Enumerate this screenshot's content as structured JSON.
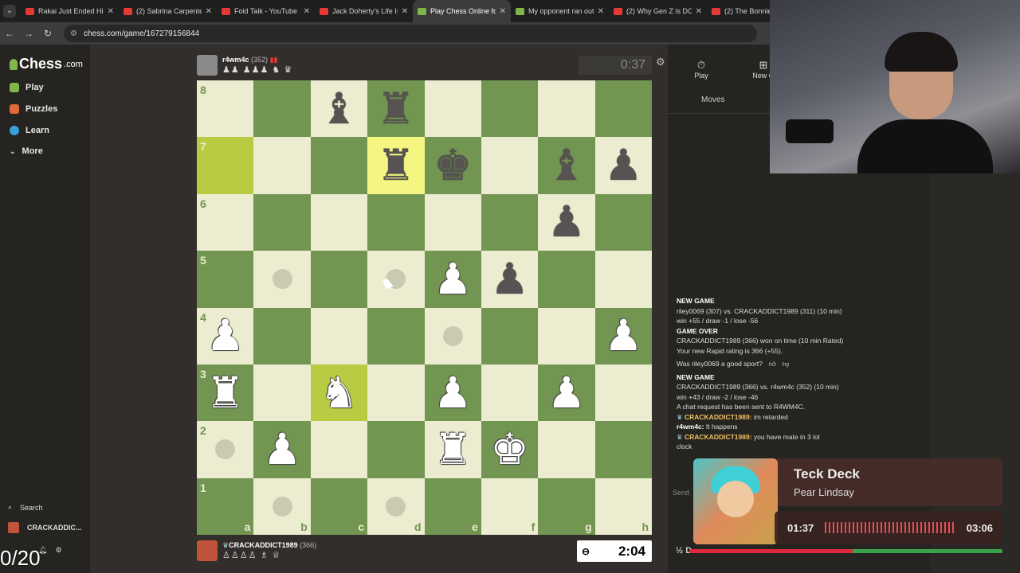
{
  "browser": {
    "tabs": [
      {
        "label": "Rakai Just Ended His",
        "favicon": "youtube",
        "active": false
      },
      {
        "label": "(2) Sabrina Carpenter",
        "favicon": "youtube",
        "active": false
      },
      {
        "label": "Foid Talk - YouTube",
        "favicon": "youtube",
        "active": false
      },
      {
        "label": "Jack Doherty's Life Is",
        "favicon": "youtube",
        "active": false
      },
      {
        "label": "Play Chess Online for",
        "favicon": "chess",
        "active": true
      },
      {
        "label": "My opponent ran out",
        "favicon": "chess",
        "active": false
      },
      {
        "label": "(2) Why Gen Z is DO",
        "favicon": "youtube",
        "active": false
      },
      {
        "label": "(2) The Bonnie F",
        "favicon": "youtube",
        "active": false
      }
    ],
    "url": "chess.com/game/167279156844"
  },
  "sidebar": {
    "logo_main": "Chess",
    "logo_suffix": ".com",
    "items": [
      {
        "label": "Play",
        "color": "#81b64c"
      },
      {
        "label": "Puzzles",
        "color": "#e0693a"
      },
      {
        "label": "Learn",
        "color": "#3aa0d8"
      },
      {
        "label": "More",
        "color": "#999999"
      }
    ],
    "search_label": "Search",
    "username": "CRACKADDIC..."
  },
  "overlay_counter": "0/20",
  "opponent": {
    "name": "r4wm4c",
    "rating": "(352)",
    "captured": "♟♟ ♟♟♟ ♞ ♛",
    "clock": "0:37"
  },
  "player": {
    "name": "CRACKADDICT1989",
    "rating": "(366)",
    "captured": "♙♙♙♙ ♗ ♕",
    "clock": "2:04"
  },
  "board": {
    "ranks": [
      "8",
      "7",
      "6",
      "5",
      "4",
      "3",
      "2",
      "1"
    ],
    "files": [
      "a",
      "b",
      "c",
      "d",
      "e",
      "f",
      "g",
      "h"
    ],
    "rows": [
      [
        "",
        "",
        "b:bishop",
        "b:rook",
        "",
        "",
        "",
        ""
      ],
      [
        "hl",
        "",
        "",
        "b:rook:hl",
        "b:king",
        "",
        "b:bishop",
        "b:pawn"
      ],
      [
        "",
        "",
        "",
        "",
        "",
        "",
        "b:pawn",
        ""
      ],
      [
        "",
        "dot",
        "",
        "dot",
        "w:pawn",
        "b:pawn",
        "",
        ""
      ],
      [
        "w:pawn",
        "",
        "",
        "",
        "dot",
        "",
        "",
        "w:pawn"
      ],
      [
        "w:rook",
        "",
        "w:knight:hl",
        "",
        "w:pawn",
        "",
        "w:pawn",
        ""
      ],
      [
        "dot",
        "w:pawn",
        "",
        "",
        "w:rook",
        "w:king",
        "",
        ""
      ],
      [
        "",
        "dot",
        "",
        "dot",
        "",
        "",
        "",
        ""
      ]
    ]
  },
  "right_panel": {
    "tab_play": "Play",
    "tab_new": "New G",
    "moves_tab": "Moves",
    "chat_input_placeholder": "Send",
    "draw_label": "½ D"
  },
  "log": [
    {
      "type": "bold",
      "text": "NEW GAME"
    },
    {
      "type": "text",
      "text": "riley0069 (307) vs. CRACKADDICT1989 (311) (10 min)"
    },
    {
      "type": "text",
      "text": "win +55 / draw -1 / lose -56"
    },
    {
      "type": "bold",
      "text": "GAME OVER"
    },
    {
      "type": "text",
      "text": "CRACKADDICT1989 (366) won on time (10 min Rated)"
    },
    {
      "type": "text",
      "text": "Your new Rapid rating is 366 (+55)."
    },
    {
      "type": "question",
      "text": "Was riley0069 a good sport?"
    },
    {
      "type": "bold",
      "text": "NEW GAME"
    },
    {
      "type": "text",
      "text": "CRACKADDICT1989 (366) vs. r4wm4c (352) (10 min)"
    },
    {
      "type": "text",
      "text": "win +43 / draw -2 / lose -46"
    },
    {
      "type": "text",
      "text": "A chat request has been sent to R4WM4C."
    },
    {
      "type": "user",
      "user": "CRACKADDICT1989:",
      "text": " im retarded"
    },
    {
      "type": "plain",
      "user": "r4wm4c:",
      "text": " It happens"
    },
    {
      "type": "user",
      "user": "CRACKADDICT1989:",
      "text": " you have mate in 3 lol"
    },
    {
      "type": "text",
      "text": "clock"
    }
  ],
  "spotify": {
    "title": "Teck Deck",
    "artist": "Pear Lindsay",
    "elapsed": "01:37",
    "duration": "03:06",
    "progress": 0.52
  }
}
